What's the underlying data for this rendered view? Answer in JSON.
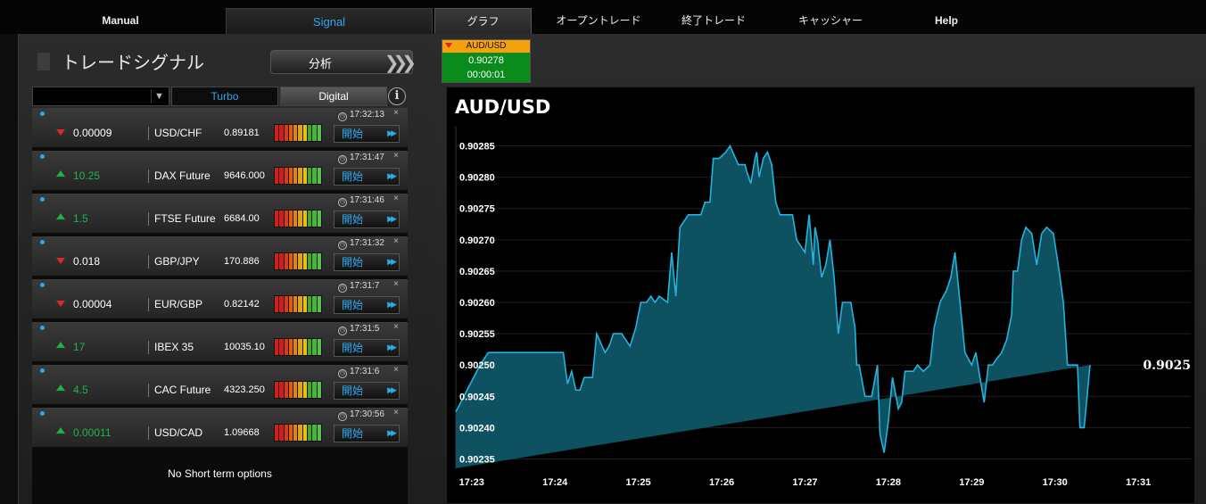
{
  "nav": {
    "tabs": [
      "Manual",
      "Signal",
      "グラフ",
      "オープントレード",
      "終了トレード",
      "キャッシャー",
      "Help"
    ]
  },
  "left": {
    "title": "トレードシグナル",
    "analyze_label": "分析",
    "filter_value": "",
    "mode_tabs": [
      "Turbo",
      "Digital"
    ],
    "info_icon": "i",
    "start_label": "開始",
    "signals": [
      {
        "time": "17:32:13",
        "direction": "down",
        "value": "0.00009",
        "asset": "USD/CHF",
        "price": "0.89181"
      },
      {
        "time": "17:31:47",
        "direction": "up",
        "value": "10.25",
        "asset": "DAX Future",
        "price": "9646.000"
      },
      {
        "time": "17:31:46",
        "direction": "up",
        "value": "1.5",
        "asset": "FTSE Future",
        "price": "6684.00"
      },
      {
        "time": "17:31:32",
        "direction": "down",
        "value": "0.018",
        "asset": "GBP/JPY",
        "price": "170.886"
      },
      {
        "time": "17:31:7",
        "direction": "down",
        "value": "0.00004",
        "asset": "EUR/GBP",
        "price": "0.82142"
      },
      {
        "time": "17:31:5",
        "direction": "up",
        "value": "17",
        "asset": "IBEX 35",
        "price": "10035.10"
      },
      {
        "time": "17:31:6",
        "direction": "up",
        "value": "4.5",
        "asset": "CAC Future",
        "price": "4323.250"
      },
      {
        "time": "17:30:56",
        "direction": "up",
        "value": "0.00011",
        "asset": "USD/CAD",
        "price": "1.09668"
      }
    ],
    "no_short": "No Short term options"
  },
  "asset_tab": {
    "name": "AUD/USD",
    "price": "0.90278",
    "timer": "00:00:01"
  },
  "colors": {
    "accent": "#2fa7e8",
    "up": "#22b24c",
    "down": "#e0242a",
    "tab_orange": "#f4a10b",
    "tab_green": "#0a8b1c",
    "area_fill": "#0f5566",
    "line": "#22b4dc"
  },
  "chart_data": {
    "type": "area",
    "title": "AUD/USD",
    "last_value_label": "0.9025",
    "y_ticks": [
      "0.90285",
      "0.90280",
      "0.90275",
      "0.90270",
      "0.90265",
      "0.90260",
      "0.90255",
      "0.90250",
      "0.90245",
      "0.90240",
      "0.90235"
    ],
    "x_ticks": [
      "17:23",
      "17:24",
      "17:25",
      "17:26",
      "17:27",
      "17:28",
      "17:29",
      "17:30",
      "17:31"
    ],
    "ylim": [
      0.902335,
      0.902875
    ],
    "xlim_minutes": [
      22.81,
      31.63
    ],
    "x": [
      22.81,
      23.1,
      23.2,
      23.3,
      23.5,
      23.8,
      24.0,
      24.1,
      24.15,
      24.2,
      24.25,
      24.3,
      24.35,
      24.45,
      24.5,
      24.6,
      24.65,
      24.7,
      24.8,
      24.85,
      24.9,
      24.97,
      25.03,
      25.1,
      25.15,
      25.2,
      25.25,
      25.35,
      25.4,
      25.45,
      25.5,
      25.55,
      25.6,
      25.65,
      25.7,
      25.75,
      25.8,
      25.86,
      25.9,
      25.97,
      26.05,
      26.1,
      26.2,
      26.28,
      26.3,
      26.35,
      26.4,
      26.42,
      26.45,
      26.5,
      26.55,
      26.6,
      26.65,
      26.7,
      26.72,
      26.8,
      26.85,
      26.9,
      27.0,
      27.05,
      27.1,
      27.12,
      27.15,
      27.2,
      27.25,
      27.3,
      27.35,
      27.4,
      27.45,
      27.5,
      27.55,
      27.6,
      27.62,
      27.65,
      27.72,
      27.8,
      27.87,
      27.9,
      27.95,
      28.0,
      28.05,
      28.12,
      28.16,
      28.2,
      28.25,
      28.3,
      28.35,
      28.42,
      28.5,
      28.55,
      28.62,
      28.7,
      28.75,
      28.8,
      28.86,
      28.92,
      29.0,
      29.05,
      29.1,
      29.15,
      29.2,
      29.25,
      29.3,
      29.36,
      29.42,
      29.48,
      29.5,
      29.55,
      29.6,
      29.65,
      29.72,
      29.78,
      29.84,
      29.9,
      29.98,
      30.05,
      30.1,
      30.15,
      30.2,
      30.27,
      30.3,
      30.35,
      30.42,
      30.47,
      30.55,
      30.6,
      30.65,
      30.7,
      30.75,
      30.8,
      30.85,
      30.9,
      30.92,
      30.95,
      31.0,
      31.05,
      31.1,
      31.15,
      31.2,
      31.25,
      31.3,
      31.35,
      31.4,
      31.45,
      31.5,
      31.55,
      31.63
    ],
    "y": [
      0.902425,
      0.9025,
      0.90252,
      0.90252,
      0.90252,
      0.90252,
      0.90252,
      0.90252,
      0.90247,
      0.90249,
      0.90246,
      0.90246,
      0.90248,
      0.90248,
      0.90255,
      0.90252,
      0.90253,
      0.90255,
      0.90255,
      0.90254,
      0.90253,
      0.90256,
      0.9026,
      0.9026,
      0.90261,
      0.9026,
      0.90261,
      0.9026,
      0.90268,
      0.90261,
      0.90272,
      0.90273,
      0.90274,
      0.90274,
      0.90274,
      0.90274,
      0.90276,
      0.90276,
      0.90283,
      0.90283,
      0.90284,
      0.90285,
      0.90282,
      0.90282,
      0.90281,
      0.90279,
      0.90283,
      0.90284,
      0.9028,
      0.90283,
      0.90284,
      0.90282,
      0.90276,
      0.90274,
      0.90274,
      0.90274,
      0.90274,
      0.9027,
      0.90268,
      0.90274,
      0.90266,
      0.90272,
      0.9027,
      0.90264,
      0.90266,
      0.9027,
      0.90264,
      0.90255,
      0.9026,
      0.9026,
      0.9026,
      0.90256,
      0.9025,
      0.9025,
      0.90245,
      0.90245,
      0.9025,
      0.90239,
      0.90236,
      0.90241,
      0.90248,
      0.90243,
      0.90244,
      0.90249,
      0.90249,
      0.90249,
      0.9025,
      0.90249,
      0.9025,
      0.90256,
      0.9026,
      0.90262,
      0.90264,
      0.90268,
      0.9026,
      0.90252,
      0.9025,
      0.90252,
      0.90248,
      0.90244,
      0.9025,
      0.9025,
      0.90251,
      0.90252,
      0.90254,
      0.90258,
      0.90265,
      0.90265,
      0.9027,
      0.90272,
      0.90271,
      0.90266,
      0.90271,
      0.90272,
      0.90271,
      0.90265,
      0.9026,
      0.9025,
      0.9025,
      0.9025,
      0.9024,
      0.9024,
      0.9025
    ],
    "grid": true,
    "color": "#22b4dc"
  }
}
